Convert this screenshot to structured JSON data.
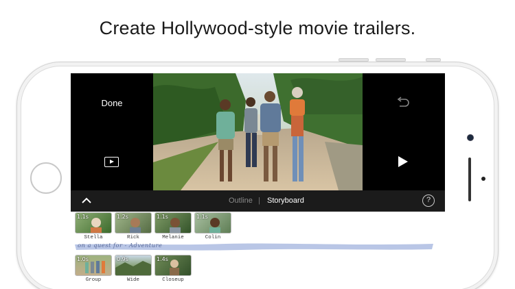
{
  "headline": "Create Hollywood-style movie trailers.",
  "editor": {
    "done_label": "Done",
    "colors": {
      "background": "#000000",
      "toolbar": "#1b1b1b",
      "storyboard": "#ffffff",
      "caption_accent": "#b9c6e6"
    }
  },
  "toolbar": {
    "segments": [
      {
        "label": "Outline",
        "selected": false
      },
      {
        "label": "Storyboard",
        "selected": true
      }
    ],
    "divider": "|",
    "help_label": "?"
  },
  "storyboard": {
    "row1": [
      {
        "duration": "1.1s",
        "name": "Stella"
      },
      {
        "duration": "1.2s",
        "name": "Rick"
      },
      {
        "duration": "1.1s",
        "name": "Melanie"
      },
      {
        "duration": "1.1s",
        "name": "Colin"
      }
    ],
    "caption": "on a quest for - Adventure",
    "row2": [
      {
        "duration": "1.0s",
        "name": "Group"
      },
      {
        "duration": "0.9s",
        "name": "Wide"
      },
      {
        "duration": "1.4s",
        "name": "Closeup"
      }
    ]
  },
  "icons": {
    "undo": "undo-icon",
    "play_small": "play-icon",
    "play_big": "play-icon",
    "collapse": "chevron-up-icon",
    "help": "help-icon"
  }
}
